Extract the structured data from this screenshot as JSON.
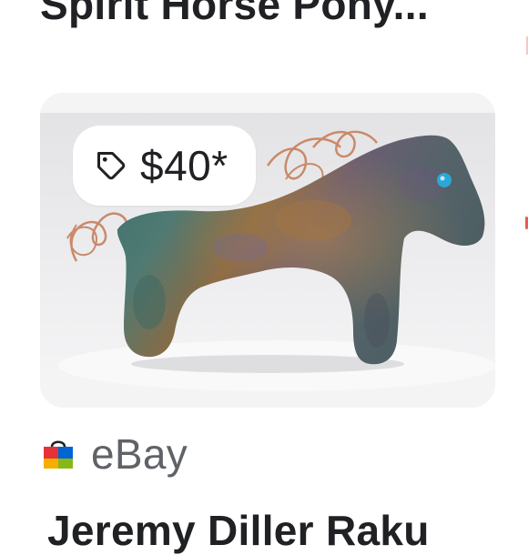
{
  "result_card": {
    "title_top": "Spirit Horse Pony...",
    "price": "$40*",
    "source_name": "eBay",
    "title_bottom": "Jeremy Diller Raku"
  },
  "icons": {
    "price_tag": "tag-icon",
    "source_logo": "ebay-bag-icon"
  },
  "colors": {
    "text_primary": "#202124",
    "text_secondary": "#5f6368",
    "card_bg": "#e9e9ea",
    "chip_bg": "#ffffff"
  }
}
